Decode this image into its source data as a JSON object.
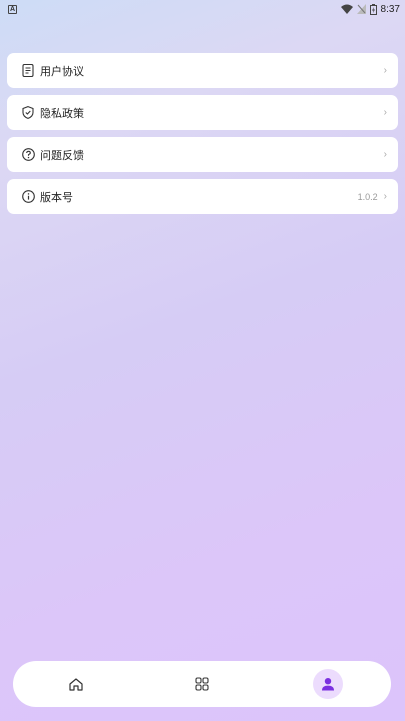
{
  "status_bar": {
    "notification_icon": "A",
    "time": "8:37"
  },
  "menu": [
    {
      "label": "用户协议",
      "icon": "document-icon",
      "value": ""
    },
    {
      "label": "隐私政策",
      "icon": "shield-icon",
      "value": ""
    },
    {
      "label": "问题反馈",
      "icon": "question-icon",
      "value": ""
    },
    {
      "label": "版本号",
      "icon": "info-icon",
      "value": "1.0.2"
    }
  ],
  "chevron": "›",
  "bottom_nav": {
    "items": [
      {
        "icon": "home-icon",
        "active": false
      },
      {
        "icon": "apps-icon",
        "active": false
      },
      {
        "icon": "profile-icon",
        "active": true
      }
    ],
    "accent_color": "#7b2fe0"
  }
}
